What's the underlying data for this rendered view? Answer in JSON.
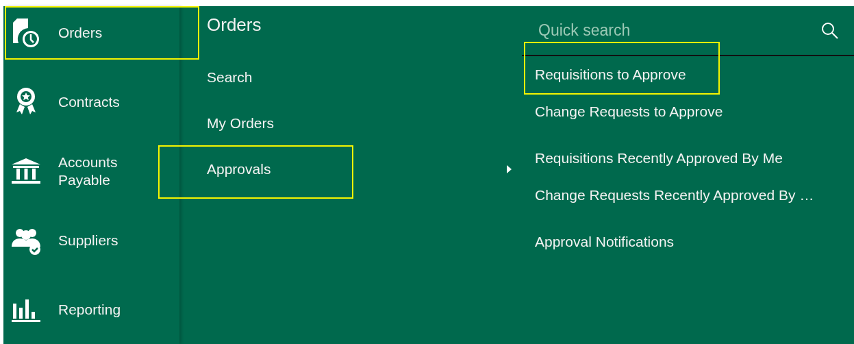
{
  "sidebar": {
    "items": [
      {
        "label": "Orders",
        "kind": "orders",
        "highlighted": true
      },
      {
        "label": "Contracts",
        "kind": "contracts",
        "highlighted": false
      },
      {
        "label": "Accounts Payable",
        "kind": "bank",
        "highlighted": false
      },
      {
        "label": "Suppliers",
        "kind": "suppliers",
        "highlighted": false
      },
      {
        "label": "Reporting",
        "kind": "reporting",
        "highlighted": false
      }
    ]
  },
  "menu": {
    "title": "Orders",
    "items": [
      {
        "label": "Search",
        "highlighted": false,
        "expanded": false
      },
      {
        "label": "My Orders",
        "highlighted": false,
        "expanded": false
      },
      {
        "label": "Approvals",
        "highlighted": true,
        "expanded": true
      }
    ]
  },
  "submenu": {
    "search": {
      "placeholder": "Quick search"
    },
    "sections": [
      [
        {
          "label": "Requisitions to Approve",
          "highlighted": true
        },
        {
          "label": "Change Requests to Approve",
          "highlighted": false
        }
      ],
      [
        {
          "label": "Requisitions Recently Approved By Me",
          "highlighted": false
        },
        {
          "label": "Change Requests Recently Approved By …",
          "highlighted": false
        }
      ],
      [
        {
          "label": "Approval Notifications",
          "highlighted": false
        }
      ]
    ]
  }
}
